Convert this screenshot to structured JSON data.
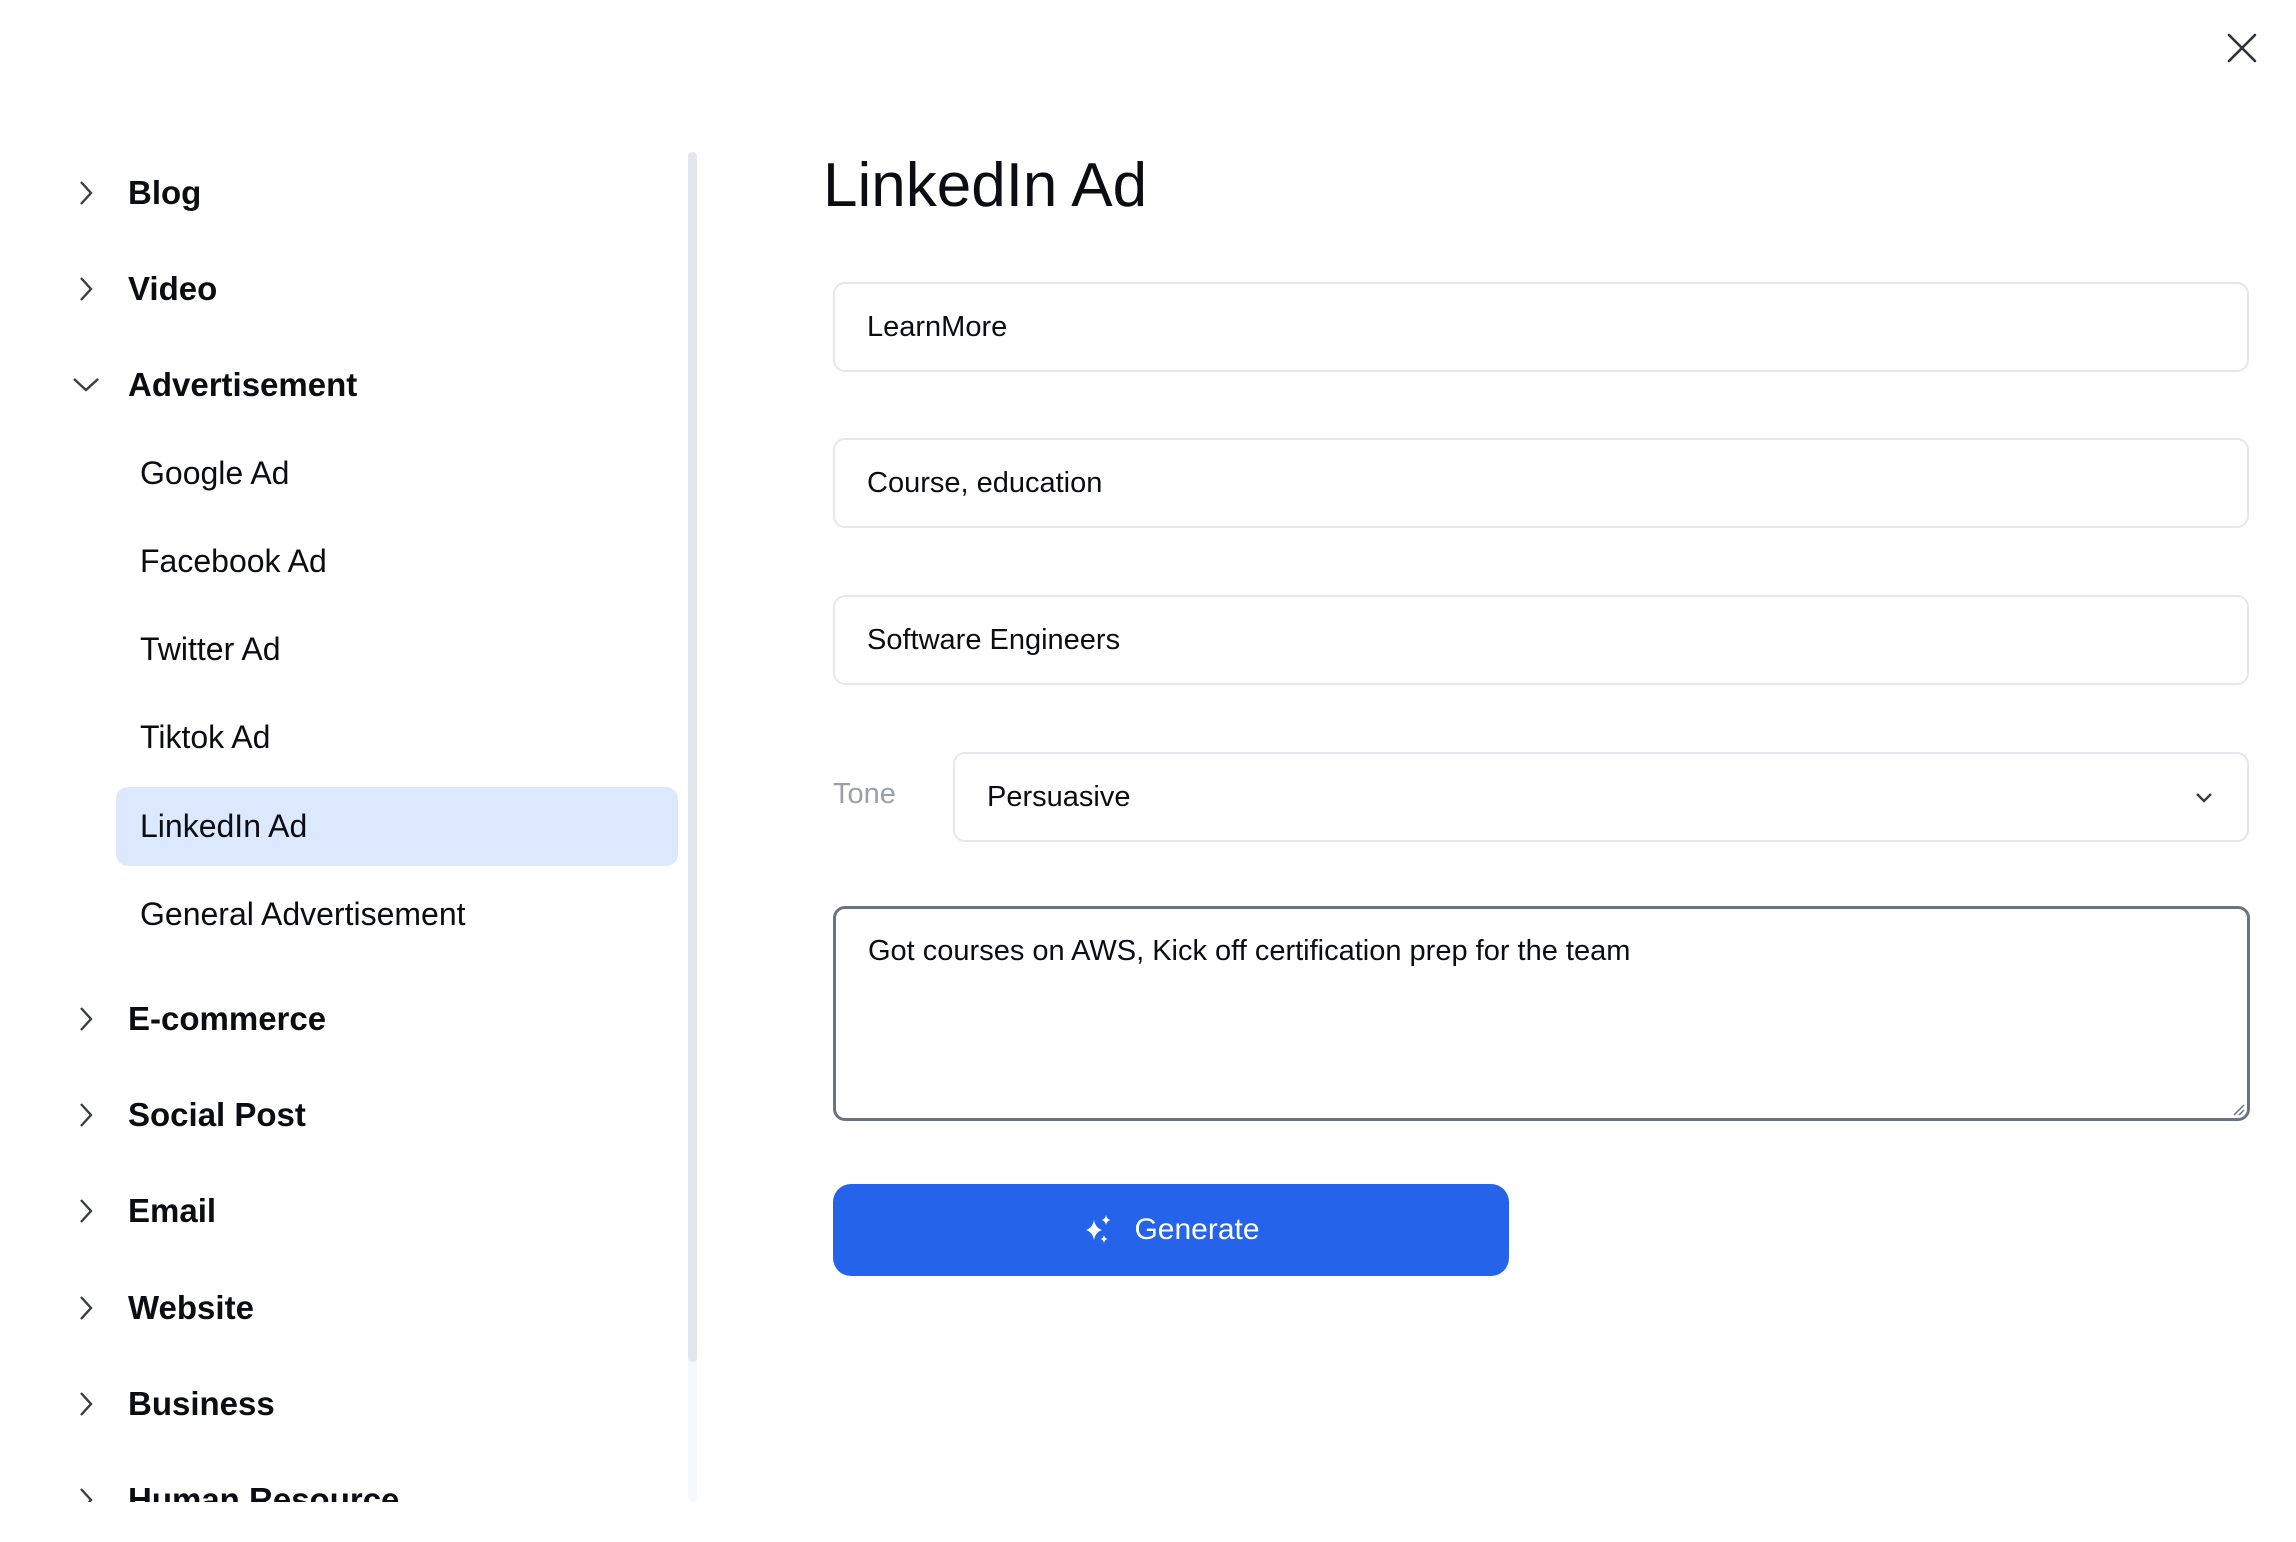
{
  "header": {
    "close_icon": "close-icon"
  },
  "sidebar": {
    "categories": [
      {
        "label": "Blog",
        "expanded": false
      },
      {
        "label": "Video",
        "expanded": false
      },
      {
        "label": "Advertisement",
        "expanded": true,
        "children": [
          {
            "label": "Google Ad",
            "active": false
          },
          {
            "label": "Facebook Ad",
            "active": false
          },
          {
            "label": "Twitter Ad",
            "active": false
          },
          {
            "label": "Tiktok Ad",
            "active": false
          },
          {
            "label": "LinkedIn Ad",
            "active": true
          },
          {
            "label": "General Advertisement",
            "active": false
          }
        ]
      },
      {
        "label": "E-commerce",
        "expanded": false
      },
      {
        "label": "Social Post",
        "expanded": false
      },
      {
        "label": "Email",
        "expanded": false
      },
      {
        "label": "Website",
        "expanded": false
      },
      {
        "label": "Business",
        "expanded": false
      },
      {
        "label": "Human Resource",
        "expanded": false
      }
    ]
  },
  "form": {
    "title": "LinkedIn Ad",
    "fields": [
      {
        "value": "LearnMore"
      },
      {
        "value": "Course, education"
      },
      {
        "value": "Software Engineers"
      }
    ],
    "tone": {
      "label": "Tone",
      "selected": "Persuasive"
    },
    "description": {
      "value": "Got courses on AWS, Kick off certification prep for the team"
    },
    "generate_label": "Generate"
  },
  "colors": {
    "accent": "#2563eb",
    "active_item_bg": "#dbe8fd",
    "muted_text": "#9aa0a8"
  }
}
